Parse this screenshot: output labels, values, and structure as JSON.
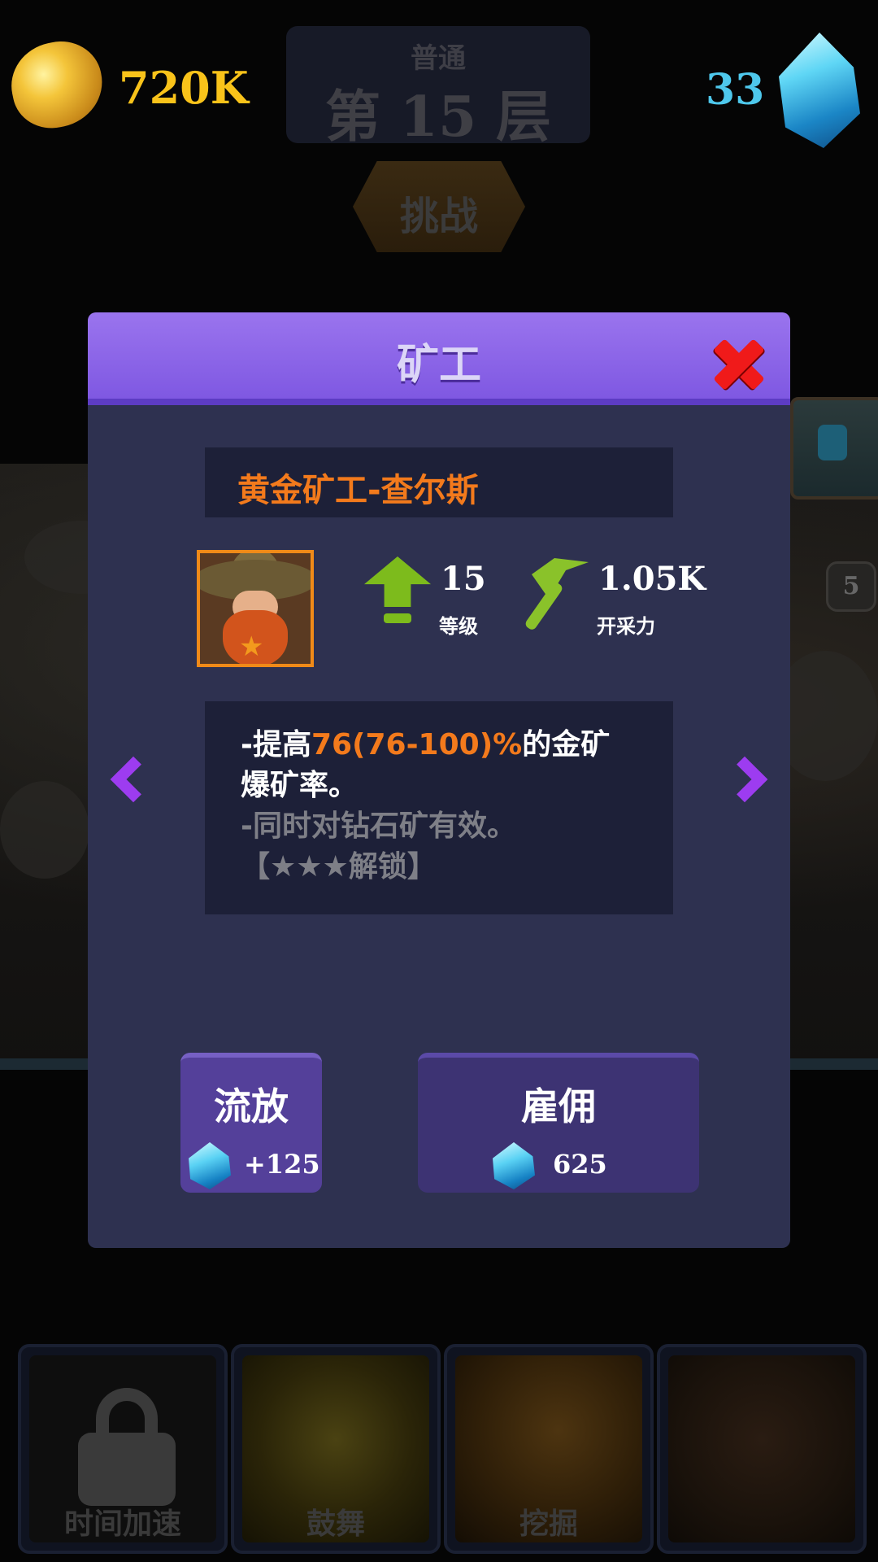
{
  "resources": {
    "gold": "720K",
    "gems": "33"
  },
  "floor": {
    "mode": "普通",
    "title": "第 15 层"
  },
  "challenge_label": "挑战",
  "background_badge": "5",
  "modal": {
    "title": "矿工",
    "miner_name": "黄金矿工-查尔斯",
    "level": {
      "value": "15",
      "label": "等级"
    },
    "mining_power": {
      "value": "1.05K",
      "label": "开采力"
    },
    "description": {
      "line1_prefix": "-提高",
      "line1_highlight": "76(76-100)%",
      "line1_suffix": "的金矿",
      "line2": "爆矿率。",
      "line3": "-同时对钻石矿有效。",
      "line4": "【★★★解锁】"
    },
    "dismiss": {
      "label": "流放",
      "cost": "+125"
    },
    "hire": {
      "label": "雇佣",
      "cost": "625"
    }
  },
  "skills": [
    {
      "label": "时间加速",
      "locked": true
    },
    {
      "label": "鼓舞",
      "locked": false
    },
    {
      "label": "挖掘",
      "locked": false
    },
    {
      "label": "",
      "locked": false
    }
  ],
  "colors": {
    "accent_purple": "#7f58e2",
    "highlight_orange": "#f37a1c",
    "gem_blue": "#4ec8ec",
    "gold_yellow": "#f9c31a",
    "close_red": "#f01a1a"
  }
}
